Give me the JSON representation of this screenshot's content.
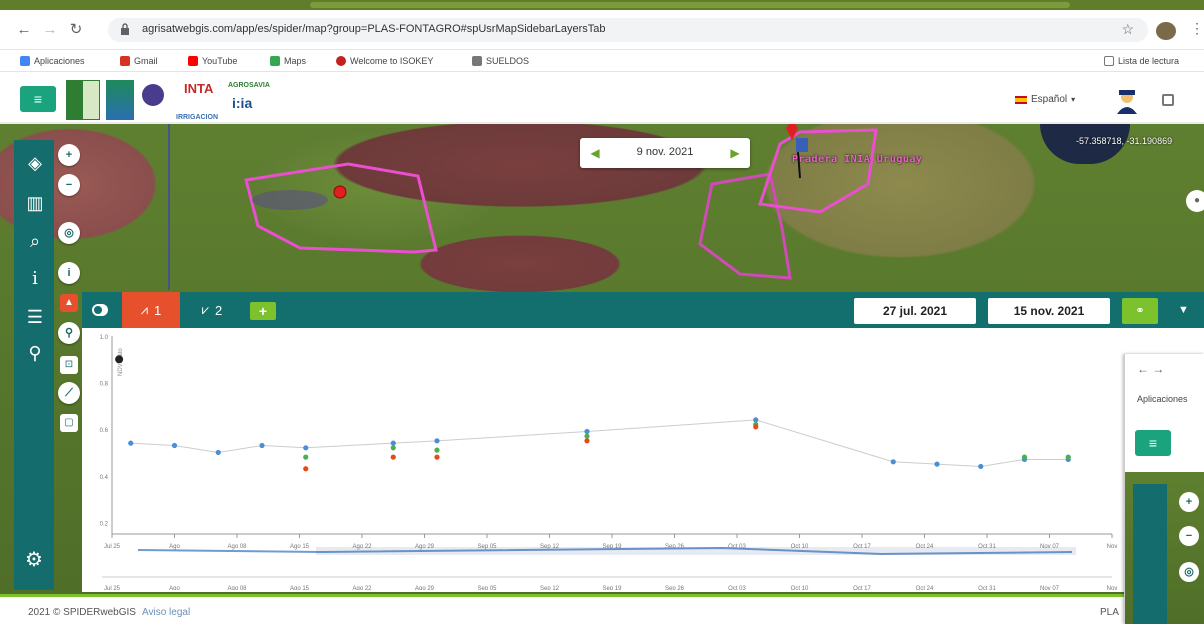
{
  "browser": {
    "url": "agrisatwebgis.com/app/es/spider/map?group=PLAS-FONTAGRO#spUsrMapSidebarLayersTab",
    "bookmarks": [
      {
        "label": "Aplicaciones",
        "color": "#4285f4"
      },
      {
        "label": "Gmail",
        "color": "#d93025"
      },
      {
        "label": "YouTube",
        "color": "#ff0000"
      },
      {
        "label": "Maps",
        "color": "#34a853"
      },
      {
        "label": "Welcome to ISOKEY",
        "color": "#c5221f"
      },
      {
        "label": "SUELDOS",
        "color": "#777777"
      }
    ],
    "reading_list": "Lista de lectura"
  },
  "header": {
    "menu_icon": "hamburger-icon",
    "logos": [
      "INIA",
      "INTA",
      "AGROSAVIA",
      "i:ia",
      "IRRIGACION"
    ],
    "language": "Español"
  },
  "map": {
    "coords": "-57.358718, -31.190869",
    "current_date": "9 nov. 2021",
    "farm_label": "Pradera INIA Uruguay"
  },
  "chart_toolbar": {
    "tab1_label": "1",
    "tab2_label": "2",
    "add_label": "+",
    "start_date": "27 jul. 2021",
    "end_date": "15 nov. 2021"
  },
  "chart_data": {
    "type": "scatter",
    "ylabel": "NDVI dato",
    "ylim": [
      0.15,
      1.0
    ],
    "yticks": [
      0.2,
      0.4,
      0.6,
      0.8,
      1.0
    ],
    "xticks": [
      "Jul 25",
      "Ago",
      "Ago 08",
      "Ago 15",
      "Ago 22",
      "Ago 29",
      "Sep 05",
      "Sep 12",
      "Sep 19",
      "Sep 26",
      "Oct 03",
      "Oct 10",
      "Oct 17",
      "Oct 24",
      "Oct 31",
      "Nov 07",
      "Nov"
    ],
    "series": [
      {
        "color": "#4a8fd6",
        "points": [
          [
            0.3,
            0.54
          ],
          [
            1.0,
            0.53
          ],
          [
            1.7,
            0.5
          ],
          [
            2.4,
            0.53
          ],
          [
            3.1,
            0.52
          ],
          [
            4.5,
            0.54
          ],
          [
            5.2,
            0.55
          ],
          [
            7.6,
            0.59
          ],
          [
            10.3,
            0.64
          ],
          [
            12.5,
            0.46
          ],
          [
            13.2,
            0.45
          ],
          [
            13.9,
            0.44
          ],
          [
            14.6,
            0.47
          ],
          [
            15.3,
            0.47
          ]
        ]
      },
      {
        "color": "#4caf50",
        "points": [
          [
            3.1,
            0.48
          ],
          [
            4.5,
            0.52
          ],
          [
            5.2,
            0.51
          ],
          [
            7.6,
            0.57
          ],
          [
            10.3,
            0.62
          ],
          [
            14.6,
            0.48
          ],
          [
            15.3,
            0.48
          ]
        ]
      },
      {
        "color": "#e64a19",
        "points": [
          [
            3.1,
            0.43
          ],
          [
            4.5,
            0.48
          ],
          [
            5.2,
            0.48
          ],
          [
            7.6,
            0.55
          ],
          [
            10.3,
            0.61
          ]
        ]
      }
    ],
    "outlier": {
      "x": 0.05,
      "y": 0.9,
      "color": "#222222"
    }
  },
  "footer": {
    "copyright": "2021 © SPIDERwebGIS",
    "legal": "Aviso legal",
    "right_text": "PLA"
  }
}
